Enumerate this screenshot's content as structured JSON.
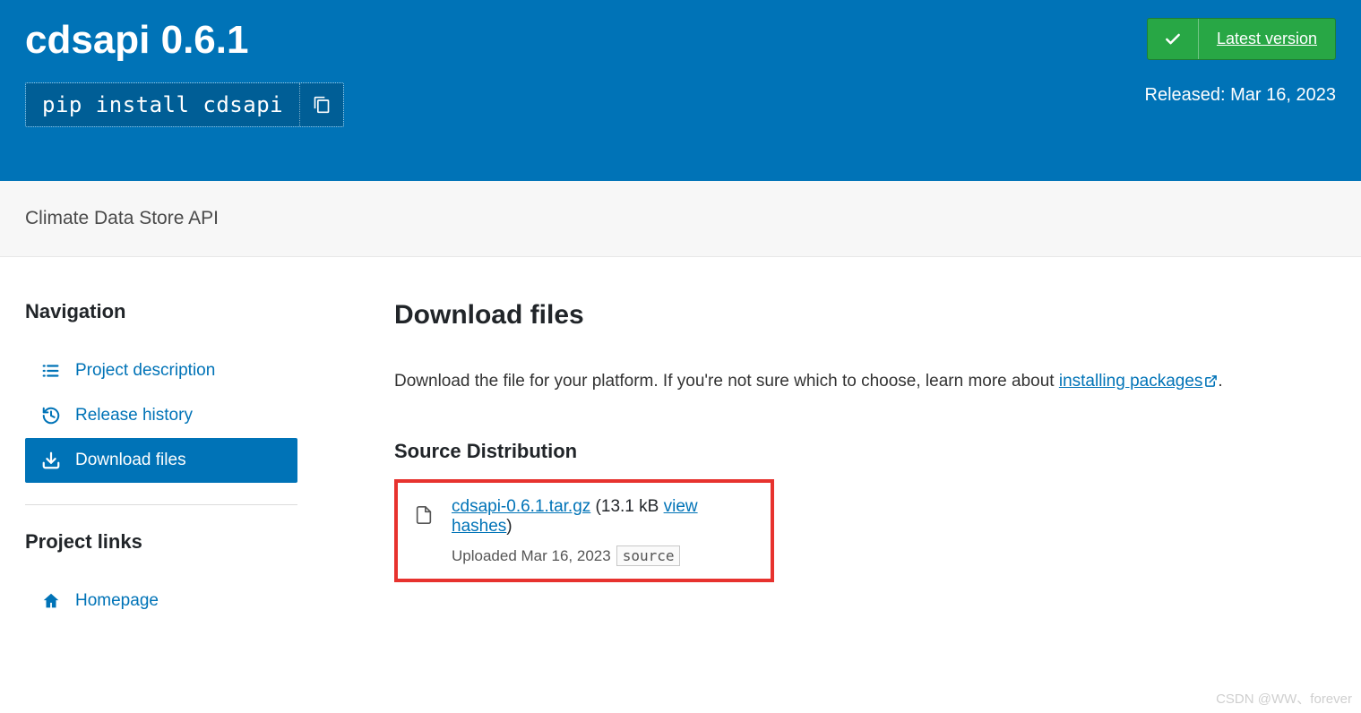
{
  "header": {
    "title": "cdsapi 0.6.1",
    "pip_command": "pip install cdsapi",
    "latest_version_label": "Latest version",
    "released_label": "Released: Mar 16, 2023"
  },
  "summary": "Climate Data Store API",
  "sidebar": {
    "nav_heading": "Navigation",
    "items": [
      {
        "label": "Project description"
      },
      {
        "label": "Release history"
      },
      {
        "label": "Download files"
      }
    ],
    "links_heading": "Project links",
    "links": [
      {
        "label": "Homepage"
      }
    ]
  },
  "content": {
    "title": "Download files",
    "lead_prefix": "Download the file for your platform. If you're not sure which to choose, learn more about ",
    "lead_link": "installing packages",
    "lead_suffix": ".",
    "source_heading": "Source Distribution",
    "file": {
      "name": "cdsapi-0.6.1.tar.gz",
      "size_text": "(13.1 kB ",
      "hashes_link": "view hashes",
      "size_suffix": ")",
      "uploaded": "Uploaded Mar 16, 2023",
      "tag": "source"
    }
  },
  "watermark": "CSDN @WW、forever"
}
